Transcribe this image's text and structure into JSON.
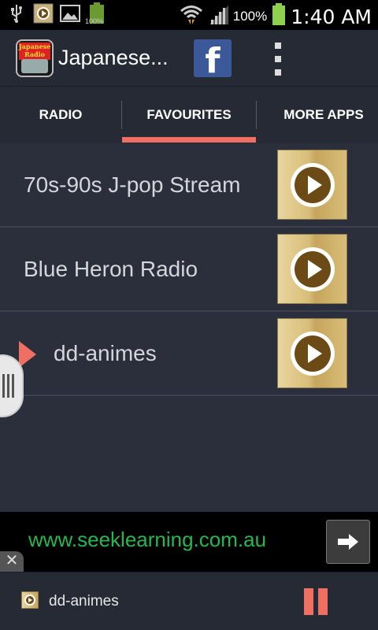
{
  "status_bar": {
    "battery_small_label": "100%",
    "battery_percent": "100%",
    "time": "1:40 AM"
  },
  "action_bar": {
    "app_title": "Japanese...",
    "app_logo_text": "Japanese Radio",
    "facebook_glyph": "f"
  },
  "tabs": [
    {
      "label": "RADIO",
      "selected": false
    },
    {
      "label": "FAVOURITES",
      "selected": true
    },
    {
      "label": "MORE APPS",
      "selected": false
    }
  ],
  "favourites": [
    {
      "name": "70s-90s J-pop Stream",
      "now_playing": false
    },
    {
      "name": "Blue Heron Radio",
      "now_playing": false
    },
    {
      "name": "dd-animes",
      "now_playing": true
    }
  ],
  "ad": {
    "text": "www.seeklearning.com.au",
    "close_glyph": "✕"
  },
  "player": {
    "title": "dd-animes",
    "state": "playing"
  },
  "colors": {
    "accent": "#ef6f63",
    "background": "#2b2f3c",
    "bar": "#262a35",
    "ad_text": "#26b84c",
    "facebook": "#3b5998"
  },
  "icons": {
    "status": [
      "usb-icon",
      "media-icon",
      "image-icon",
      "battery-small-icon",
      "wifi-icon",
      "signal-icon",
      "battery-icon"
    ],
    "row_action": "play-icon",
    "player_action": "pause-icon",
    "ad_action": "arrow-right-icon",
    "menu": "overflow-menu-icon"
  }
}
